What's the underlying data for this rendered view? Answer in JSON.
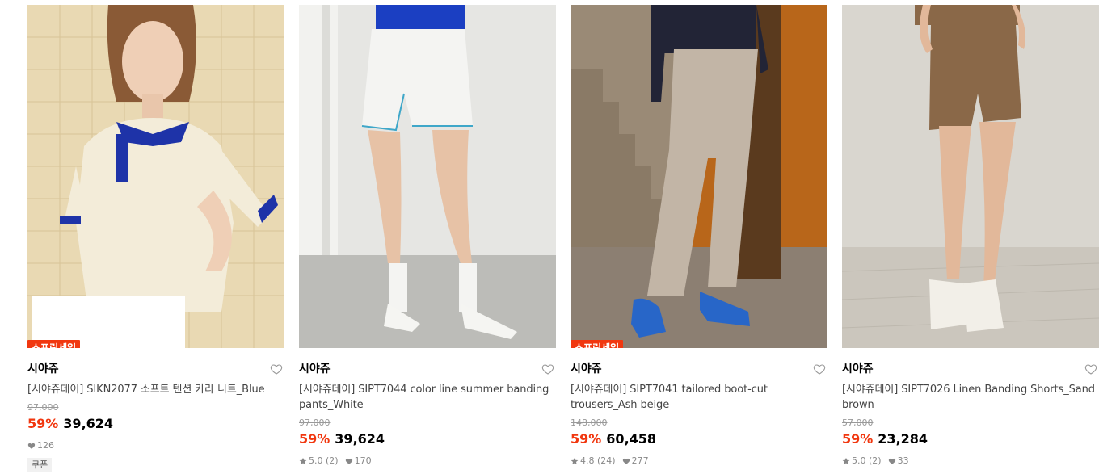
{
  "products": [
    {
      "badge": "스프링세일",
      "brand": "시야쥬",
      "name": "[시야쥬데이] SIKN2077 소프트 텐션 카라 니트_Blue",
      "original_price": "97,000",
      "discount": "59%",
      "price": "39,624",
      "likes": "126",
      "coupon": "쿠폰"
    },
    {
      "brand": "시야쥬",
      "name": "[시야쥬데이] SIPT7044 color line summer banding pants_White",
      "original_price": "97,000",
      "discount": "59%",
      "price": "39,624",
      "rating": "5.0 (2)",
      "likes": "170"
    },
    {
      "badge": "스프링세일",
      "brand": "시야쥬",
      "name": "[시야쥬데이] SIPT7041 tailored boot-cut trousers_Ash beige",
      "original_price": "148,000",
      "discount": "59%",
      "price": "60,458",
      "rating": "4.8 (24)",
      "likes": "277"
    },
    {
      "brand": "시야쥬",
      "name": "[시야쥬데이] SIPT7026 Linen Banding Shorts_Sand brown",
      "original_price": "57,000",
      "discount": "59%",
      "price": "23,284",
      "rating": "5.0 (2)",
      "likes": "33"
    }
  ],
  "colors": {
    "sale": "#f1370f",
    "muted": "#888888"
  },
  "icons": {
    "wishlist": "heart-outline-icon",
    "rating": "star-icon",
    "likes": "heart-filled-icon"
  }
}
